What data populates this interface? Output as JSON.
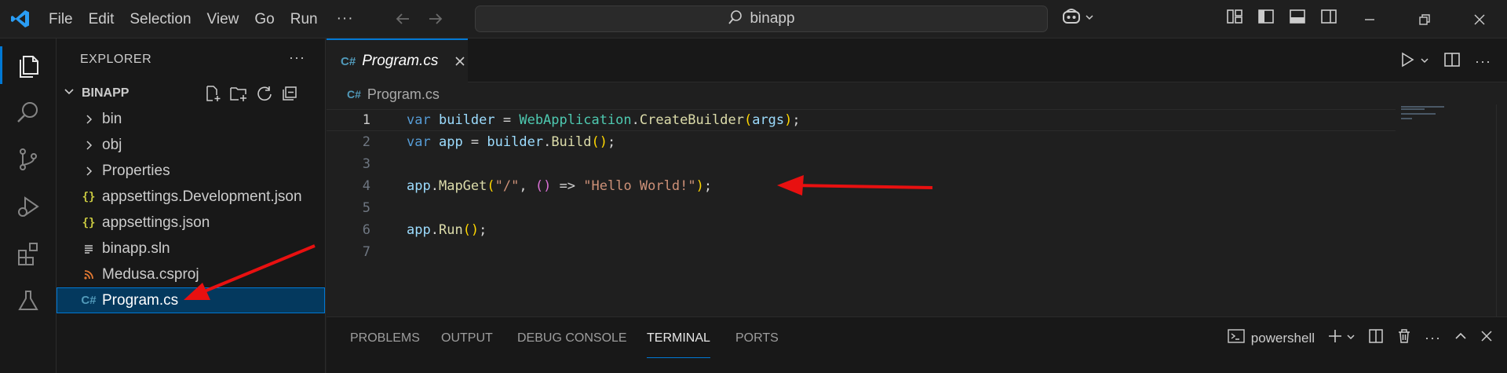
{
  "menu": [
    "File",
    "Edit",
    "Selection",
    "View",
    "Go",
    "Run"
  ],
  "menu_more": "···",
  "search": {
    "text": "binapp"
  },
  "sidebar": {
    "title": "EXPLORER",
    "more": "···",
    "project": "BINAPP",
    "items": [
      {
        "label": "bin",
        "icon": "chevron-right-icon"
      },
      {
        "label": "obj",
        "icon": "chevron-right-icon"
      },
      {
        "label": "Properties",
        "icon": "chevron-right-icon"
      },
      {
        "label": "appsettings.Development.json",
        "icon": "json-icon"
      },
      {
        "label": "appsettings.json",
        "icon": "json-icon"
      },
      {
        "label": "binapp.sln",
        "icon": "lines-icon"
      },
      {
        "label": "Medusa.csproj",
        "icon": "rss-icon"
      },
      {
        "label": "Program.cs",
        "icon": "csharp-icon",
        "selected": true
      }
    ]
  },
  "editor": {
    "tab": "Program.cs",
    "breadcrumb": "Program.cs",
    "line_numbers": [
      "1",
      "2",
      "3",
      "4",
      "5",
      "6",
      "7"
    ],
    "current_line": 1
  },
  "panel": {
    "tabs": [
      "PROBLEMS",
      "OUTPUT",
      "DEBUG CONSOLE",
      "TERMINAL",
      "PORTS"
    ],
    "active_tab": "TERMINAL",
    "shell": "powershell"
  },
  "colors": {
    "accent": "#0078d4",
    "annotation_arrow": "#e81010"
  }
}
